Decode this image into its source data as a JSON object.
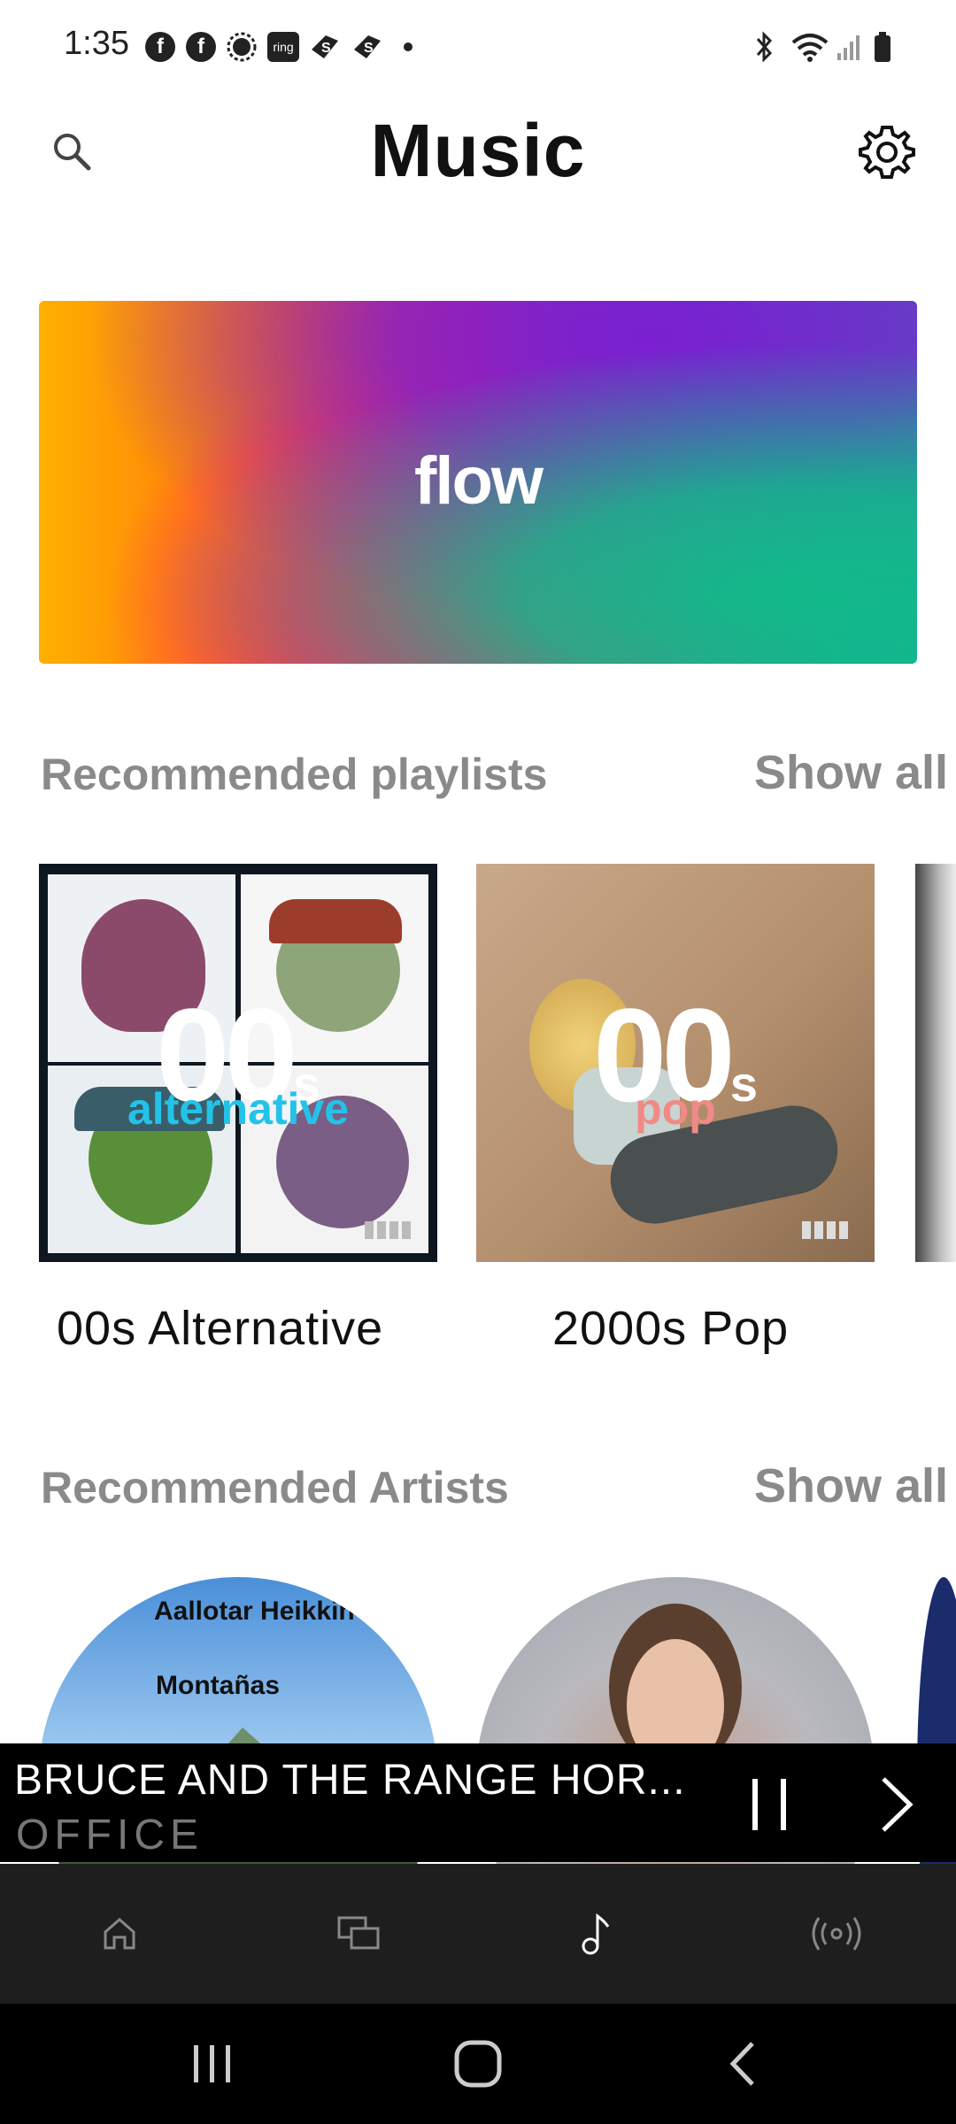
{
  "status_bar": {
    "time": "1:35",
    "notification_icons": [
      "facebook-icon",
      "facebook-icon",
      "sun-icon",
      "ring-icon",
      "sling-icon",
      "sling-icon"
    ],
    "ring_label": "ring"
  },
  "header": {
    "title": "Music",
    "search_icon": "search-icon",
    "settings_icon": "gear-icon"
  },
  "banner": {
    "label": "flow"
  },
  "playlists": {
    "section_title": "Recommended playlists",
    "show_all": "Show all",
    "items": [
      {
        "name": "00s Alternative",
        "cover_big": "00",
        "cover_suffix": "s",
        "cover_sub": "alternative",
        "cover_sub_color": "#23c3e8"
      },
      {
        "name": "2000s Pop",
        "cover_big": "00",
        "cover_suffix": "s",
        "cover_sub": "pop",
        "cover_sub_color": "#f08a86"
      }
    ]
  },
  "artists": {
    "section_title": "Recommended Artists",
    "show_all": "Show all",
    "items": [
      {
        "line1": "Aallotar Heikkin",
        "line2": "Montañas"
      },
      {
        "line1": "",
        "line2": ""
      }
    ]
  },
  "mini_player": {
    "title": "BRUCE AND THE RANGE HOR...",
    "subtitle": "OFFICE",
    "pause_icon": "pause-icon",
    "next_icon": "chevron-right-icon"
  },
  "bottom_nav": {
    "items": [
      "home-icon",
      "rooms-icon",
      "music-icon",
      "radio-icon"
    ],
    "active_index": 2
  },
  "colors": {
    "accent_text": "#8a8a8a",
    "player_bg": "#000000",
    "nav_bg": "#1e1e1e"
  }
}
